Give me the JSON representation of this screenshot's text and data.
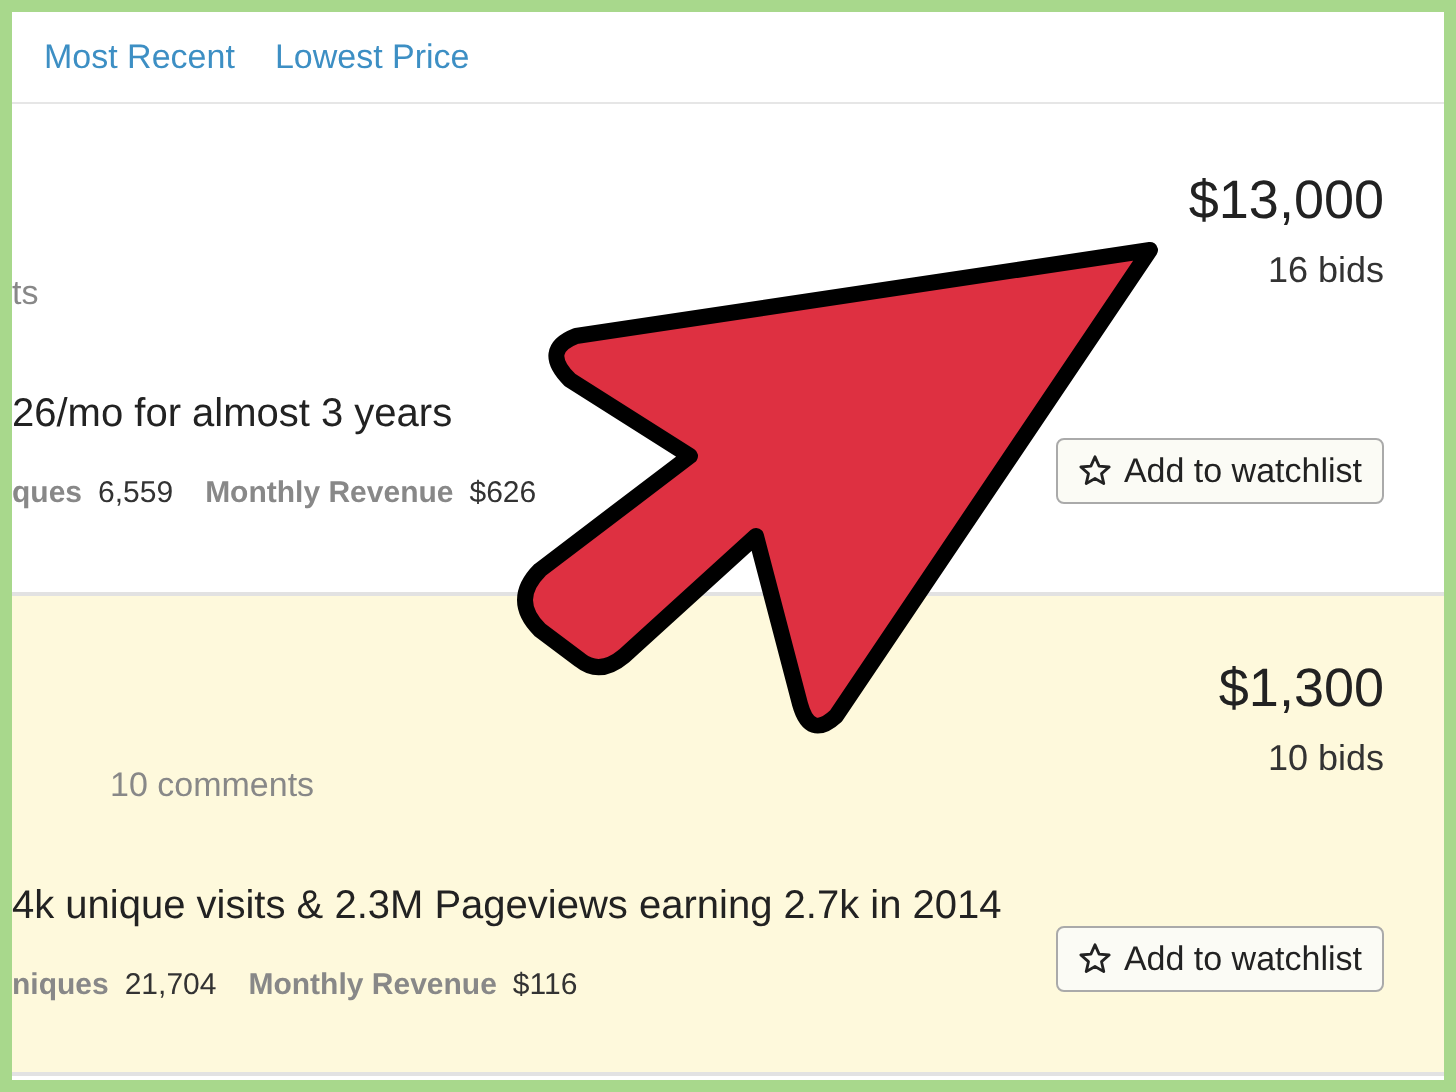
{
  "sort_links": [
    {
      "label": "Most Recent"
    },
    {
      "label": "Lowest Price"
    }
  ],
  "listings": [
    {
      "highlighted": false,
      "meta": [
        "ts"
      ],
      "title": "26/mo for almost 3 years",
      "stats": [
        {
          "label": "ques",
          "value": "6,559"
        },
        {
          "label": "Monthly Revenue",
          "value": "$626"
        }
      ],
      "price": "$13,000",
      "bids": "16 bids",
      "watch_button": "Add to watchlist"
    },
    {
      "highlighted": true,
      "meta": [
        "10 comments"
      ],
      "title": "4k unique visits & 2.3M Pageviews earning 2.7k in 2014",
      "stats": [
        {
          "label": "niques",
          "value": "21,704"
        },
        {
          "label": "Monthly Revenue",
          "value": "$116"
        }
      ],
      "price": "$1,300",
      "bids": "10 bids",
      "watch_button": "Add to watchlist"
    }
  ]
}
